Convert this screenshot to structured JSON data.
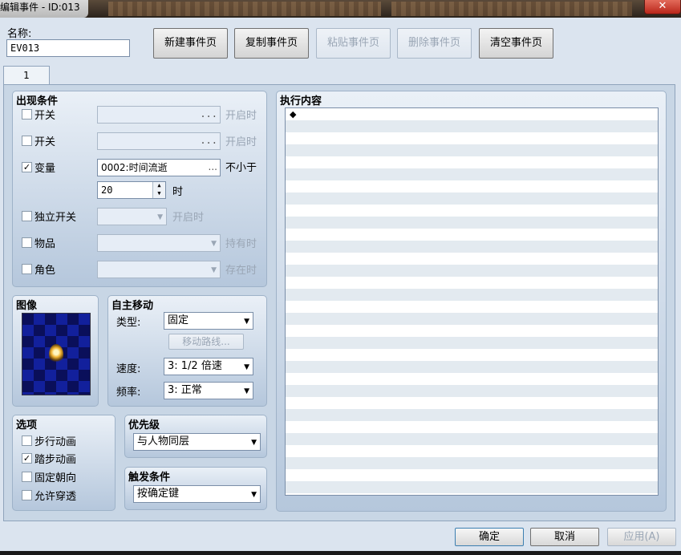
{
  "window": {
    "title": "编辑事件 - ID:013",
    "close_glyph": "✕"
  },
  "name": {
    "label": "名称:",
    "value": "EV013"
  },
  "page_buttons": [
    "新建事件页",
    "复制事件页",
    "粘贴事件页",
    "删除事件页",
    "清空事件页"
  ],
  "tabs": [
    "1"
  ],
  "conditions": {
    "title": "出现条件",
    "switch1": {
      "label": "开关",
      "checked": false,
      "value": "",
      "hint": "开启时"
    },
    "switch2": {
      "label": "开关",
      "checked": false,
      "value": "",
      "hint": "开启时"
    },
    "variable": {
      "label": "变量",
      "checked": true,
      "value": "0002:时间流逝",
      "compare": "不小于",
      "number": "20",
      "unit": "时"
    },
    "self_switch": {
      "label": "独立开关",
      "checked": false,
      "value": "",
      "hint": "开启时"
    },
    "item": {
      "label": "物品",
      "checked": false,
      "value": "",
      "hint": "持有时"
    },
    "actor": {
      "label": "角色",
      "checked": false,
      "value": "",
      "hint": "存在时"
    },
    "ellipsis": "..."
  },
  "image": {
    "title": "图像"
  },
  "autonomous": {
    "title": "自主移动",
    "type_label": "类型:",
    "type_value": "固定",
    "route_button": "移动路线...",
    "speed_label": "速度:",
    "speed_value": "3: 1/2 倍速",
    "freq_label": "频率:",
    "freq_value": "3: 正常"
  },
  "options": {
    "title": "选项",
    "walking": {
      "label": "步行动画",
      "checked": false
    },
    "stepping": {
      "label": "踏步动画",
      "checked": true
    },
    "direction_fix": {
      "label": "固定朝向",
      "checked": false
    },
    "through": {
      "label": "允许穿透",
      "checked": false
    }
  },
  "priority": {
    "title": "优先级",
    "value": "与人物同层"
  },
  "trigger": {
    "title": "触发条件",
    "value": "按确定键"
  },
  "contents": {
    "title": "执行内容",
    "first_line": "◆"
  },
  "footer": {
    "ok": "确定",
    "cancel": "取消",
    "apply": "应用(A)"
  },
  "glyphs": {
    "check": "✓",
    "dropdown": "▼",
    "spin_up": "▲",
    "spin_down": "▼"
  }
}
